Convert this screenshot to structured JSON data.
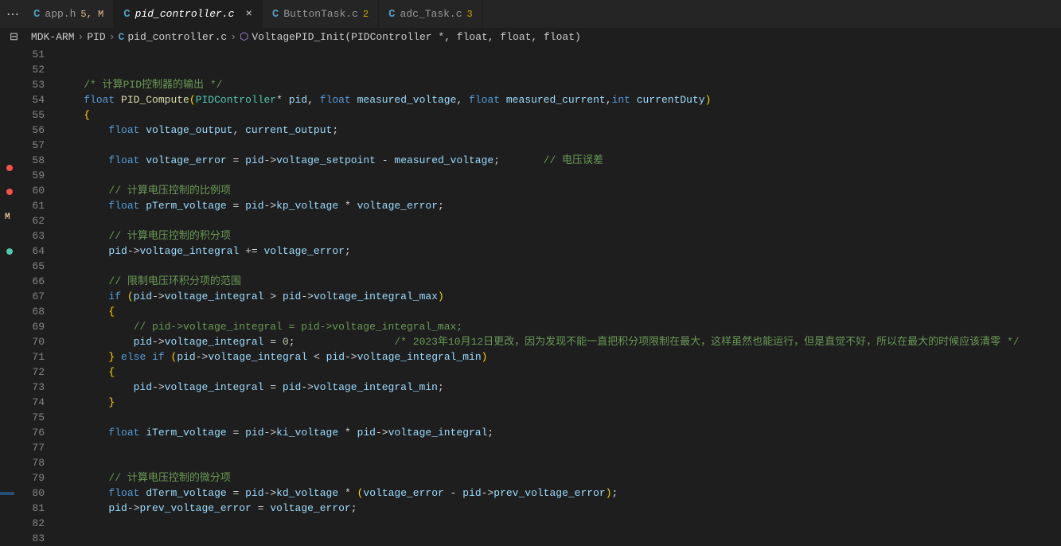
{
  "tabs": [
    {
      "icon": "C",
      "name": "app.h",
      "badge": "5, M",
      "badgeClass": "modified-badge"
    },
    {
      "icon": "C",
      "name": "pid_controller.c",
      "active": true
    },
    {
      "icon": "C",
      "name": "ButtonTask.c",
      "badge": "2",
      "badgeClass": "warning-badge"
    },
    {
      "icon": "C",
      "name": "adc_Task.c",
      "badge": "3",
      "badgeClass": "warning-badge"
    }
  ],
  "breadcrumb": {
    "parts": [
      "MDK-ARM",
      "PID"
    ],
    "fileIcon": "C",
    "fileName": "pid_controller.c",
    "method": "VoltagePID_Init(PIDController *, float, float, float)"
  },
  "lineStart": 51,
  "lineCount": 33,
  "code": {
    "l53": "/* 计算PID控制器的输出 */",
    "l54_kw1": "float",
    "l54_fn": "PID_Compute",
    "l54_cls": "PIDController",
    "l54_p1": "pid",
    "l54_kw2": "float",
    "l54_p2": "measured_voltage",
    "l54_kw3": "float",
    "l54_p3": "measured_current",
    "l54_kw4": "int",
    "l54_p4": "currentDuty",
    "l56_kw": "float",
    "l56_v1": "voltage_output",
    "l56_v2": "current_output",
    "l58_kw": "float",
    "l58_v": "voltage_error",
    "l58_pid": "pid",
    "l58_prop": "voltage_setpoint",
    "l58_mv": "measured_voltage",
    "l58_cmt": "// 电压误差",
    "l60_cmt": "// 计算电压控制的比例项",
    "l61_kw": "float",
    "l61_v": "pTerm_voltage",
    "l61_pid": "pid",
    "l61_prop": "kp_voltage",
    "l61_ve": "voltage_error",
    "l63_cmt": "// 计算电压控制的积分项",
    "l64_pid": "pid",
    "l64_prop": "voltage_integral",
    "l64_ve": "voltage_error",
    "l66_cmt": "// 限制电压环积分项的范围",
    "l67_kw": "if",
    "l67_pid": "pid",
    "l67_p1": "voltage_integral",
    "l67_p2": "voltage_integral_max",
    "l69_cmt": "// pid->voltage_integral = pid->voltage_integral_max;",
    "l70_pid": "pid",
    "l70_prop": "voltage_integral",
    "l70_num": "0",
    "l70_cmt": "/* 2023年10月12日更改，因为发现不能一直把积分项限制在最大，这样虽然也能运行，但是直觉不好，所以在最大的时候应该清零 */",
    "l71_kw1": "else",
    "l71_kw2": "if",
    "l71_pid": "pid",
    "l71_p1": "voltage_integral",
    "l71_p2": "voltage_integral_min",
    "l73_pid": "pid",
    "l73_p1": "voltage_integral",
    "l73_p2": "voltage_integral_min",
    "l76_kw": "float",
    "l76_v": "iTerm_voltage",
    "l76_pid": "pid",
    "l76_p1": "ki_voltage",
    "l76_p2": "voltage_integral",
    "l79_cmt": "// 计算电压控制的微分项",
    "l80_kw": "float",
    "l80_v": "dTerm_voltage",
    "l80_pid": "pid",
    "l80_p1": "kd_voltage",
    "l80_ve": "voltage_error",
    "l80_p2": "prev_voltage_error",
    "l81_pid": "pid",
    "l81_p1": "prev_voltage_error",
    "l81_ve": "voltage_error"
  }
}
